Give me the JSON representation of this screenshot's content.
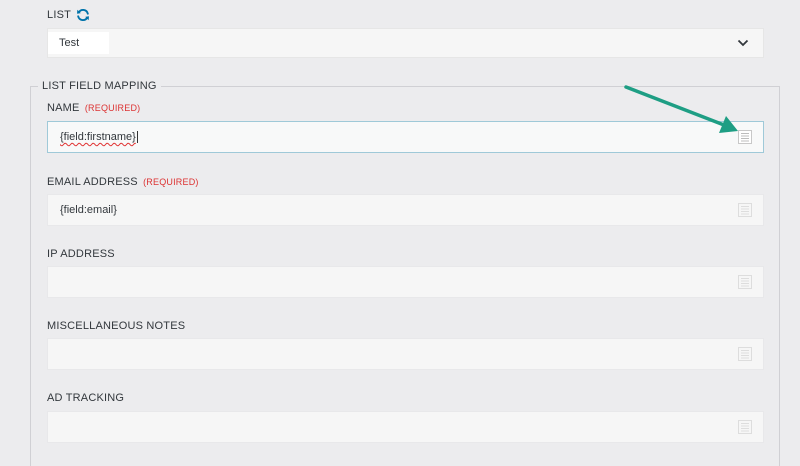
{
  "list": {
    "label": "LIST",
    "refresh_icon": "refresh-icon",
    "selected": "Test"
  },
  "mapping": {
    "legend": "LIST FIELD MAPPING",
    "required_text": "(REQUIRED)",
    "fields": [
      {
        "label": "NAME",
        "required": true,
        "value": "{field:firstname}"
      },
      {
        "label": "EMAIL ADDRESS",
        "required": true,
        "value": "{field:email}"
      },
      {
        "label": "IP ADDRESS",
        "required": false,
        "value": ""
      },
      {
        "label": "MISCELLANEOUS NOTES",
        "required": false,
        "value": ""
      },
      {
        "label": "AD TRACKING",
        "required": false,
        "value": ""
      }
    ]
  },
  "colors": {
    "accent_blue": "#0073aa",
    "required_red": "#dc3232",
    "annotation_arrow": "#1e9e84"
  }
}
